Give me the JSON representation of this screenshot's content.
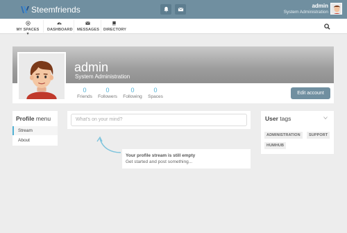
{
  "brand": {
    "name": "Steemfriends"
  },
  "user": {
    "name": "admin",
    "role": "System Administration"
  },
  "nav": {
    "items": [
      {
        "label": "MY SPACES ▾",
        "icon": "dot-circle-icon"
      },
      {
        "label": "DASHBOARD",
        "icon": "tachometer-icon"
      },
      {
        "label": "MESSAGES",
        "icon": "envelope-icon"
      },
      {
        "label": "DIRECTORY",
        "icon": "book-icon"
      }
    ]
  },
  "profile": {
    "name": "admin",
    "role": "System Administration",
    "stats": [
      {
        "value": "0",
        "label": "Friends"
      },
      {
        "value": "0",
        "label": "Followers"
      },
      {
        "value": "0",
        "label": "Following"
      },
      {
        "value": "0",
        "label": "Spaces"
      }
    ],
    "edit_label": "Edit account"
  },
  "menu": {
    "title_bold": "Profile",
    "title_rest": " menu",
    "items": [
      "Stream",
      "About"
    ]
  },
  "stream": {
    "placeholder": "What's on your mind?",
    "empty_title": "Your profile stream is still empty",
    "empty_sub": "Get started and post something..."
  },
  "tags": {
    "title_bold": "User",
    "title_rest": " tags",
    "items": [
      "ADMINISTRATION",
      "SUPPORT",
      "HUMHUB"
    ]
  },
  "colors": {
    "accent": "#708fa0",
    "link": "#4fb0d4"
  }
}
